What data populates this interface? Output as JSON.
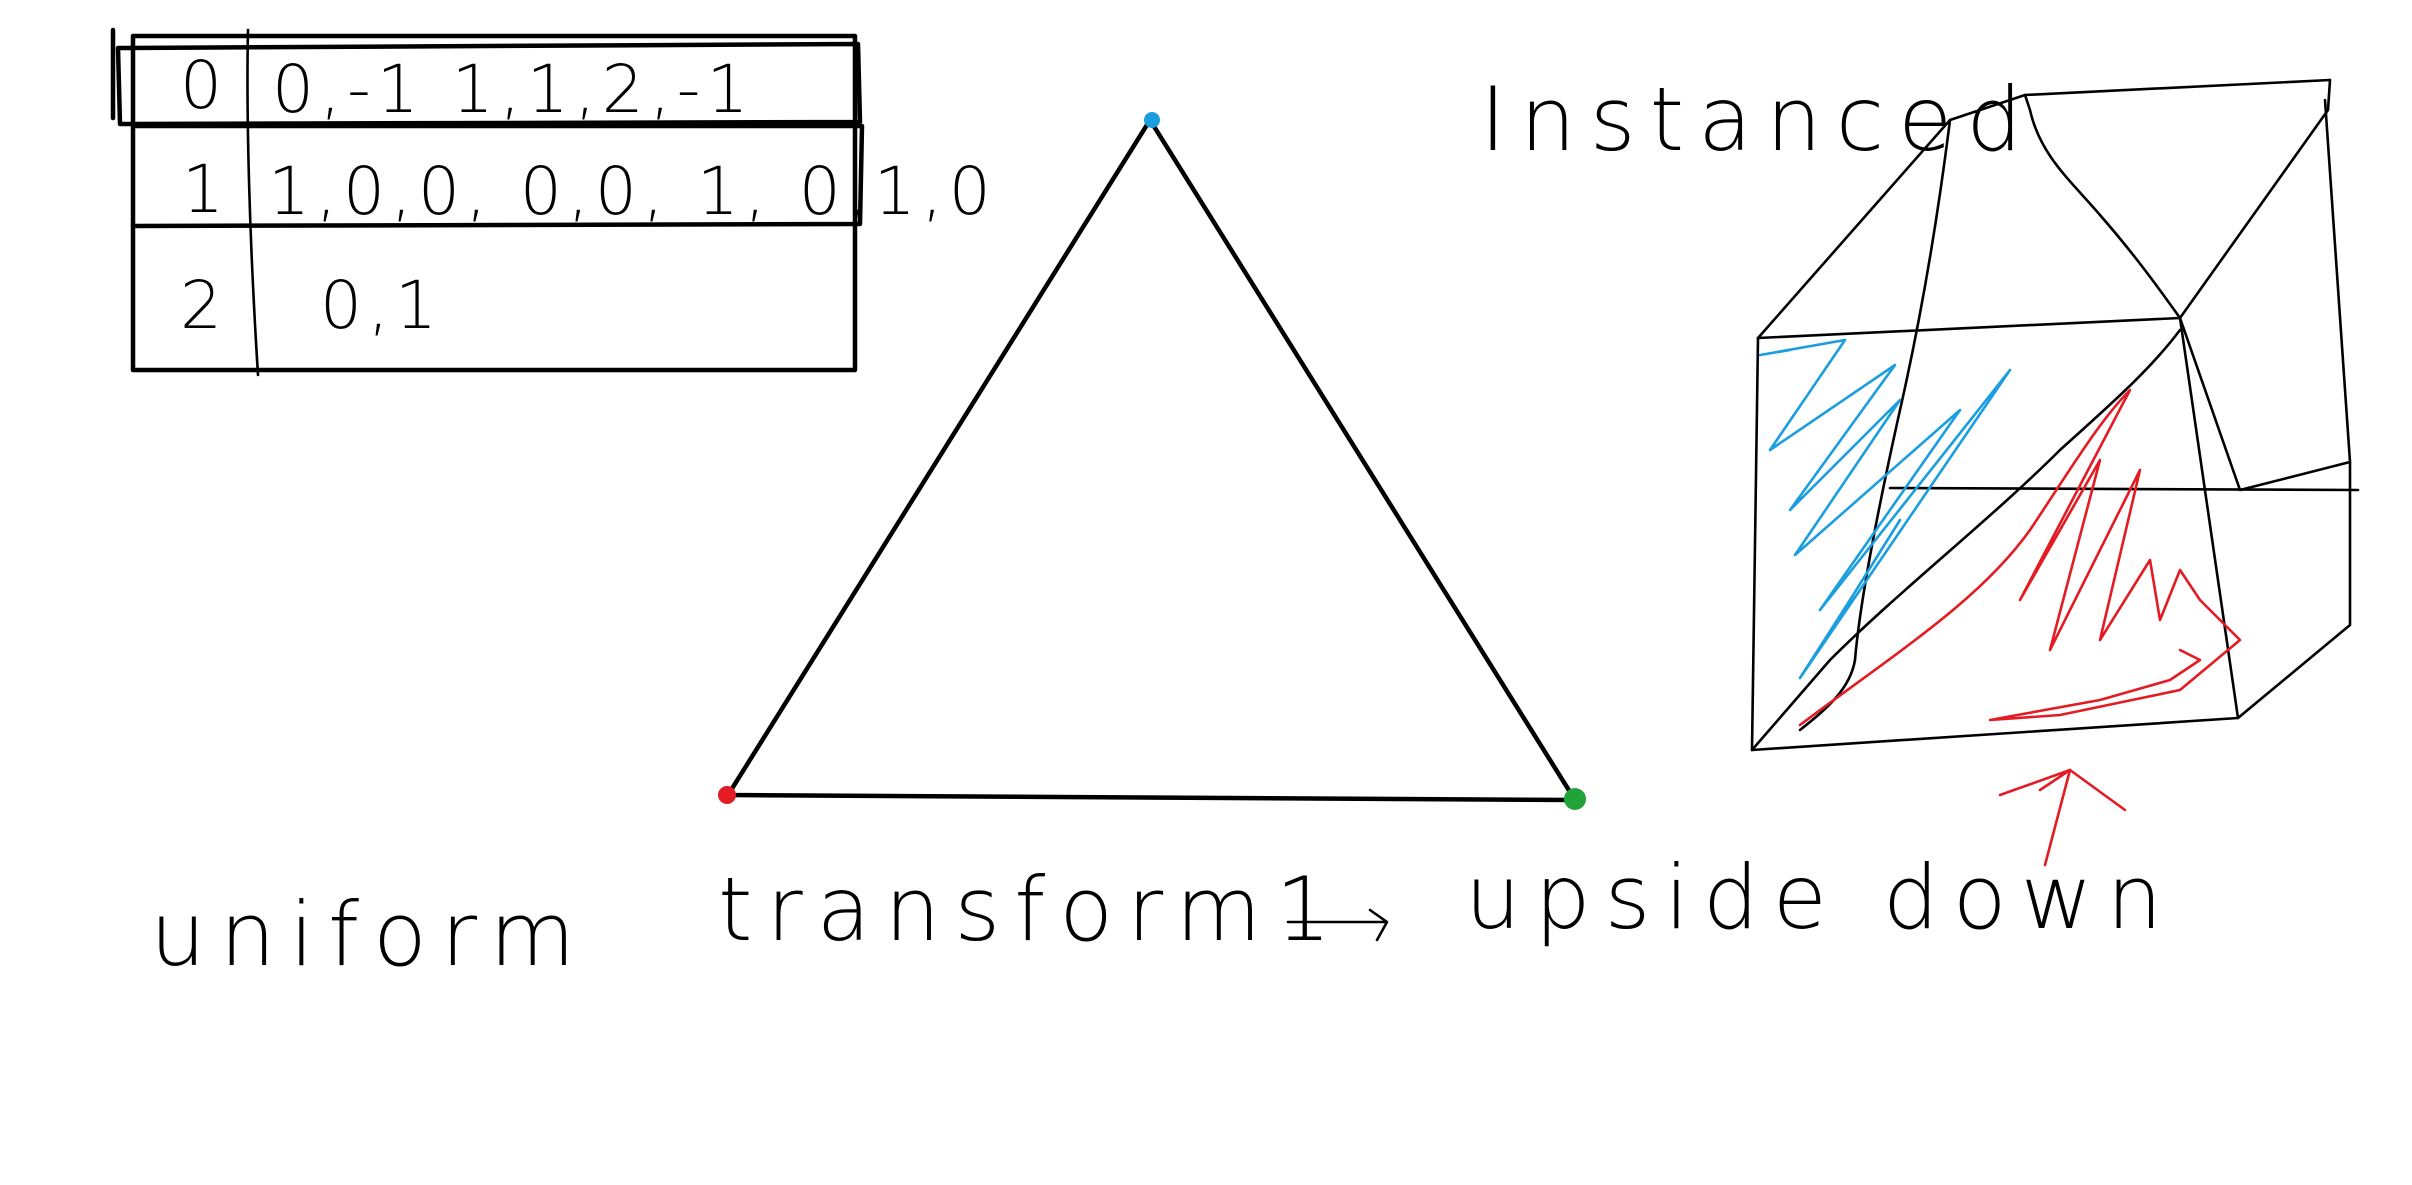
{
  "table": {
    "rows": [
      {
        "index": "0",
        "value": "0,-1 1,1,2,-1"
      },
      {
        "index": "1",
        "value": "1,0,0, 0,0, 1, 0,1,0"
      },
      {
        "index": "2",
        "value": "0,1"
      }
    ]
  },
  "labels": {
    "uniform": "uniform",
    "transform": "transform1",
    "result": "upside down",
    "instanced": "Instanced"
  },
  "colors": {
    "ink": "#000000",
    "vertex_top": "#1a9ee0",
    "vertex_left": "#e31b23",
    "vertex_right": "#22a33a",
    "scribble_blue": "#1a9ee0",
    "scribble_red": "#e31b23"
  }
}
